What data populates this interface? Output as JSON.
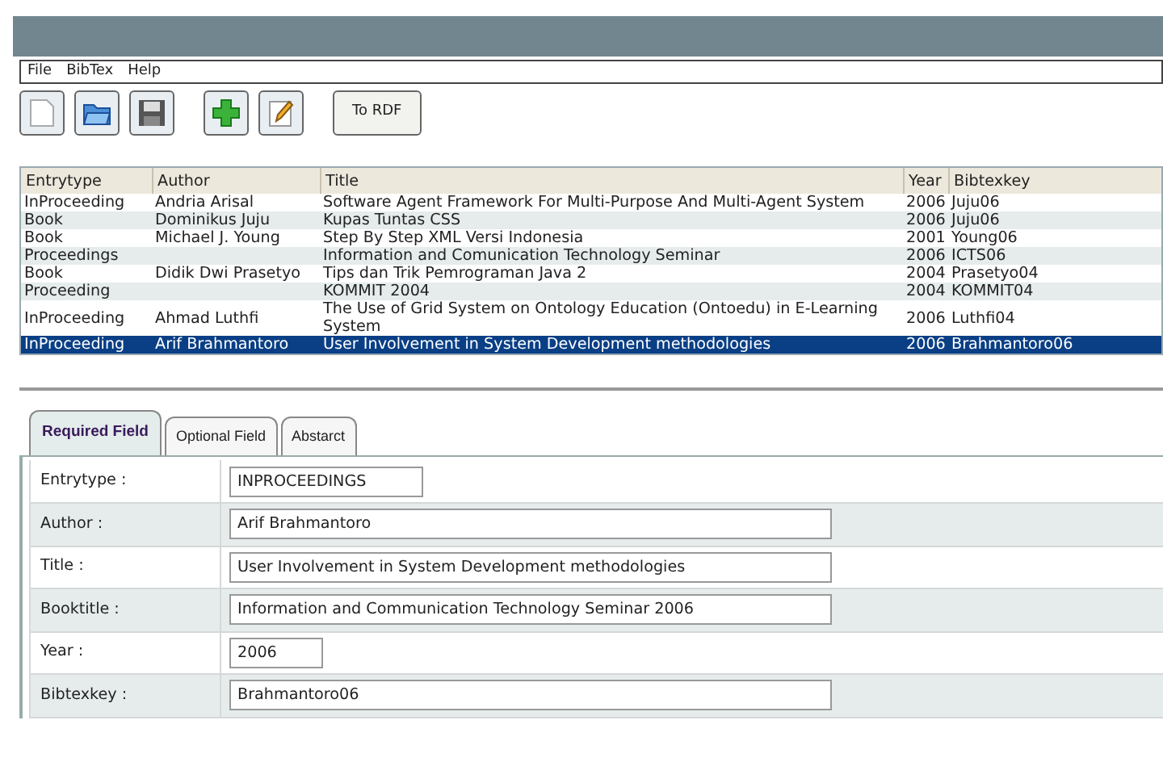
{
  "menu": [
    "File",
    "BibTex",
    "Help"
  ],
  "toolbar": [
    {
      "kind": "new"
    },
    {
      "kind": "open"
    },
    {
      "kind": "save"
    },
    {
      "kind": "add"
    },
    {
      "kind": "edit"
    },
    {
      "kind": "text",
      "label": "To RDF"
    }
  ],
  "table": {
    "columns": [
      "Entrytype",
      "Author",
      "Title",
      "Year",
      "Bibtexkey"
    ],
    "rows": [
      {
        "selected": false,
        "cells": [
          "InProceeding",
          "Andria Arisal",
          "Software Agent Framework For Multi-Purpose And Multi-Agent System",
          "2006",
          "Juju06"
        ]
      },
      {
        "selected": false,
        "cells": [
          "Book",
          "Dominikus Juju",
          "Kupas Tuntas CSS",
          "2006",
          "Juju06"
        ]
      },
      {
        "selected": false,
        "cells": [
          "Book",
          "Michael J. Young",
          "Step By Step XML Versi Indonesia",
          "2001",
          "Young06"
        ]
      },
      {
        "selected": false,
        "cells": [
          "Proceedings",
          "",
          "Information and Comunication Technology Seminar",
          "2006",
          "ICTS06"
        ]
      },
      {
        "selected": false,
        "cells": [
          "Book",
          "Didik Dwi Prasetyo",
          "Tips dan Trik Pemrograman Java 2",
          "2004",
          "Prasetyo04"
        ]
      },
      {
        "selected": false,
        "cells": [
          "Proceeding",
          "",
          "KOMMIT 2004",
          "2004",
          "KOMMIT04"
        ]
      },
      {
        "selected": false,
        "cells": [
          "InProceeding",
          "Ahmad Luthfi",
          "The Use of Grid System on Ontology Education (Ontoedu) in E-Learning System",
          "2006",
          "Luthfi04"
        ]
      },
      {
        "selected": true,
        "cells": [
          "InProceeding",
          "Arif Brahmantoro",
          "User Involvement in System Development methodologies",
          "2006",
          "Brahmantoro06"
        ]
      }
    ]
  },
  "tabs": [
    {
      "label": "Required Field",
      "selected": true
    },
    {
      "label": "Optional Field",
      "selected": false
    },
    {
      "label": "Abstarct",
      "selected": false
    }
  ],
  "form": [
    {
      "label": "Entrytype :",
      "value": "INPROCEEDINGS"
    },
    {
      "label": "Author :",
      "value": "Arif Brahmantoro"
    },
    {
      "label": "Title :",
      "value": "User Involvement in System Development methodologies"
    },
    {
      "label": "Booktitle :",
      "value": "Information and Communication Technology Seminar 2006"
    },
    {
      "label": "Year :",
      "value": "2006"
    },
    {
      "label": "Bibtexkey :",
      "value": "Brahmantoro06"
    }
  ]
}
